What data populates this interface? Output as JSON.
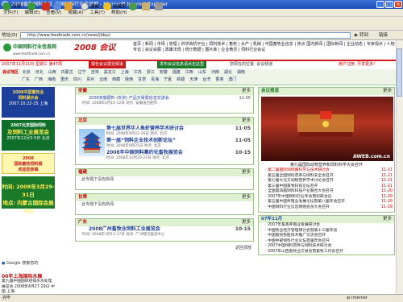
{
  "window": {
    "title": "2008畜牧饲料会议_中国饲料行业信息网 - Microsoft Internet Explorer"
  },
  "menu": [
    "文件(F)",
    "编辑(E)",
    "查看(V)",
    "收藏(A)",
    "工具(T)",
    "帮助(H)"
  ],
  "toolbar": {
    "back": "后退",
    "search": "搜索",
    "favorites": "收藏夹"
  },
  "address": {
    "label": "地址(D)",
    "url": "http://www.feedtrade.com.cn/news/jldqu/",
    "go": "转到",
    "links": "链接"
  },
  "site": {
    "logo": "中国饲料行业信息网",
    "logo_url": "www.feedtrade.com.cn",
    "banner": "2008 会议",
    "topnav": "首页 | 新闻 | 市场 | 管理 | 供求商机平台 | 饲料技术 | 畜牧 | 水产 | 机械 | 中国畜牧业信息 | 热点 国内新闻 | 国际新闻 | 企业动态 | 专家视点 | 人物专访 | 会议会展 | 政策法规 | 统计数据 | 图片库 | 企业黄页 | 饲料行业会议"
  },
  "datebar": {
    "date": "2007年11月21日  星期三  第47周",
    "left": "报告会议展览频道",
    "mid": "发布会议信息请点击这里",
    "right": "您现在的位置: 会议频道",
    "hot": "用户注册, 尽享更多!"
  },
  "provinces": {
    "label": "会议地区",
    "row1": [
      "北京",
      "河北",
      "山西",
      "内蒙古",
      "辽宁",
      "吉林",
      "黑龙江",
      "上海",
      "江苏",
      "浙江",
      "安徽",
      "福建",
      "江西",
      "山东",
      "河南",
      "湖北",
      "湖南"
    ],
    "row2": [
      "广东",
      "广西",
      "海南",
      "重庆",
      "四川",
      "贵州",
      "云南",
      "西藏",
      "陕西",
      "甘肃",
      "青海",
      "宁夏",
      "新疆",
      "天津",
      "台湾",
      "香港",
      "澳门"
    ]
  },
  "left_ads": [
    {
      "l1": "2008中国畜牧业",
      "l2": "饲料展示会",
      "l3": "2007.10.22-25 上海",
      "bg": "#1c3f9a",
      "fg": "#ffdd44"
    },
    {
      "l1": "2007北京国际饲料",
      "l2": "及饲料工业展览会",
      "l3": "2007年12月3-5日 北京",
      "bg": "#0f6e2a",
      "fg": "#ffffff"
    },
    {
      "l1": "2008",
      "l2": "国际畜牧饲料展",
      "l3": "欢迎您参展",
      "bg": "#fff6b0",
      "fg": "#c81a1a"
    },
    {
      "l1": "时间: 2008年3月29-31日",
      "l2": "地点: 内蒙古国际会展中心",
      "l3": "",
      "bg": "#1a7a2a",
      "fg": "#ffee55"
    }
  ],
  "google": "Google 搜索您的",
  "bottom_ad": {
    "title": "00年上海国际水展",
    "lines": "第九届中国国际给排水水处理展览会 2008年4月27-29日 中国 上海"
  },
  "sections": [
    {
      "name": "安徽",
      "items": [
        {
          "t": "2008安徽肥料 (农资) 产品交易暨信息交流会",
          "d": "11-05",
          "sub": "时间: 2008年3月10-12日  地点: 安徽省合肥市"
        }
      ]
    },
    {
      "name": "北京",
      "items": [
        {
          "t": "第七届世界华人鱼虾营养学术研讨会",
          "d": "11-05",
          "sub": "时间: 2008年9月22-26日  地点: 北京"
        },
        {
          "t": "第一届“饲料企业技术创新论坛”",
          "d": "11-05",
          "sub": "时间: 2008年9月25日  地点: 北京"
        },
        {
          "t": "2008年中国饲料集约化畜牧展览会",
          "d": "10-15",
          "sub": "时间: 2008年10月20-22日  地点: 北京"
        }
      ]
    },
    {
      "name": "福建",
      "items": [
        {
          "t": "此专题下没有新闻",
          "d": "",
          "sub": ""
        }
      ]
    },
    {
      "name": "甘肃",
      "items": [
        {
          "t": "此专题下没有新闻",
          "d": "",
          "sub": ""
        }
      ]
    },
    {
      "name": "广东",
      "items": [
        {
          "t": "2008广州畜牧业饲料工业展览会",
          "d": "10-15",
          "sub": "时间: 2008年3月15-17日  地点: 广州锦汉展览中心"
        }
      ]
    }
  ],
  "more_label": "更多",
  "back_top": "返回顶部",
  "right": {
    "head": "会议报道",
    "photo_text": "AWEB.com.cn",
    "caption": "第九届国际动物营养和饲料科学大会召开",
    "news": [
      {
        "t": "第二届国际饲料酶科学与技术研讨会",
        "d": "11-21"
      },
      {
        "t": "第五届全国饲料营养与饲料安全会召开",
        "d": "11-21"
      },
      {
        "t": "第七届大北方动物营养学术讨论会召开",
        "d": "11-21"
      },
      {
        "t": "第三届中国畜牧科技论坛召开",
        "d": "11-21"
      },
      {
        "t": "全国第四届饲料科技产业联合大会召开",
        "d": "11-20"
      },
      {
        "t": "2007年中国饲料行业年会暨科研会议",
        "d": "11-20"
      },
      {
        "t": "第五届中国养殖业发展论坛暨第八届年会召开",
        "d": "11-20"
      },
      {
        "t": "中国饲料行业信息网络会员大会召开",
        "d": "11-19"
      }
    ],
    "head2": "07年11月",
    "news2": [
      {
        "t": "2007年畜禽养殖业发展研讨会",
        "d": ""
      },
      {
        "t": "中国牧业经济管理研讨会暨第十三届年会",
        "d": ""
      },
      {
        "t": "中国畜牧兽医技术推广交流会召开",
        "d": ""
      },
      {
        "t": "中国中部饲料行业论坛首届年会召开",
        "d": ""
      },
      {
        "t": "2007中国饲料营养与饲料技术研讨会",
        "d": ""
      },
      {
        "t": "2007年山西畜牧业交易会暨畜牧工作会召开",
        "d": ""
      }
    ]
  },
  "status": {
    "left": "完毕",
    "zone": "Internet"
  },
  "colors": {
    "accent": "#c81a1a",
    "green": "#1a7a2a",
    "titlebar": "#2456c2"
  }
}
